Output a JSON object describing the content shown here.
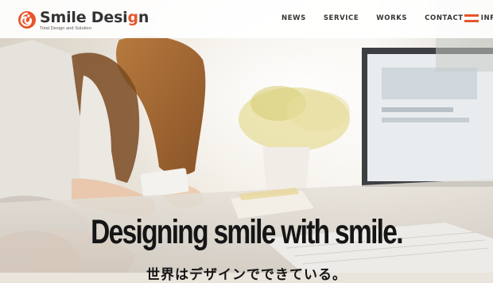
{
  "brand": {
    "name_part1": "Smile Desi",
    "name_accent": "g",
    "name_part2": "n",
    "tagline": "Total Design and Solution"
  },
  "nav": {
    "items": [
      {
        "label": "NEWS"
      },
      {
        "label": "SERVICE"
      },
      {
        "label": "WORKS"
      },
      {
        "label": "CONTACT"
      },
      {
        "label": "INFO"
      }
    ]
  },
  "hero": {
    "headline": "Designing smile with smile.",
    "subline": "世界はデザインでできている。"
  },
  "colors": {
    "accent": "#e8552b",
    "text": "#151515"
  },
  "icons": {
    "logo": "smile-logo-icon",
    "menu": "hamburger-menu-icon"
  }
}
